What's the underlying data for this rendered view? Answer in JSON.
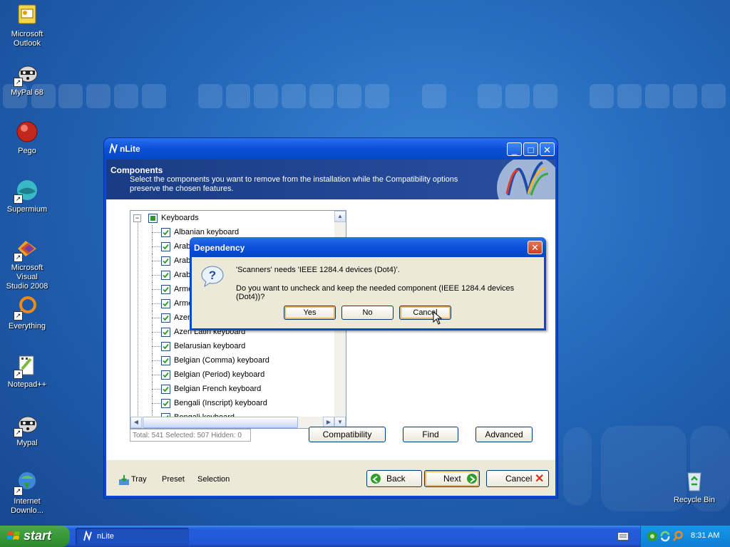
{
  "desktop": {
    "icons": [
      {
        "label": "Microsoft\nOutlook",
        "icon": "outlook-icon"
      },
      {
        "label": "MyPal 68",
        "icon": "mypal-icon"
      },
      {
        "label": "Pego",
        "icon": "pego-icon"
      },
      {
        "label": "Supermium",
        "icon": "supermium-icon"
      },
      {
        "label": "Microsoft Visual\nStudio 2008",
        "icon": "visual-studio-icon"
      },
      {
        "label": "Everything",
        "icon": "everything-icon"
      },
      {
        "label": "Notepad++",
        "icon": "notepadpp-icon"
      },
      {
        "label": "Mypal",
        "icon": "mypal-icon"
      },
      {
        "label": "Internet\nDownlo...",
        "icon": "internet-download-icon"
      },
      {
        "label": "Recycle Bin",
        "icon": "recycle-bin-icon"
      }
    ]
  },
  "window": {
    "title": "nLite",
    "section_title": "Components",
    "section_desc": "Select the components you want to remove from the installation while the Compatibility options preserve the chosen features.",
    "tree": {
      "root": "Keyboards",
      "items": [
        "Albanian keyboard",
        "Arabi",
        "Arabi",
        "Arabi",
        "Arme",
        "Arme",
        "Azeri",
        "Azeri Latin keyboard",
        "Belarusian keyboard",
        "Belgian (Comma) keyboard",
        "Belgian (Period) keyboard",
        "Belgian French keyboard",
        "Bengali (Inscript) keyboard",
        "Bengali keyboard"
      ]
    },
    "status": "Total: 541 Selected: 507 Hidden: 0",
    "panel_buttons": {
      "compatibility": "Compatibility",
      "find": "Find",
      "advanced": "Advanced"
    },
    "footer": {
      "tray": "Tray",
      "preset": "Preset",
      "selection": "Selection",
      "back": "Back",
      "next": "Next",
      "cancel": "Cancel"
    }
  },
  "dialog": {
    "title": "Dependency",
    "message1": "'Scanners' needs 'IEEE 1284.4 devices (Dot4)'.",
    "message2": "Do you want to uncheck and keep the needed component (IEEE 1284.4 devices (Dot4))?",
    "buttons": {
      "yes": "Yes",
      "no": "No",
      "cancel": "Cancel"
    }
  },
  "taskbar": {
    "start": "start",
    "task": "nLite",
    "clock": "8:31 AM"
  },
  "colors": {
    "accent": "#0a50d8",
    "desktop": "#2266b8",
    "start": "#379937"
  }
}
